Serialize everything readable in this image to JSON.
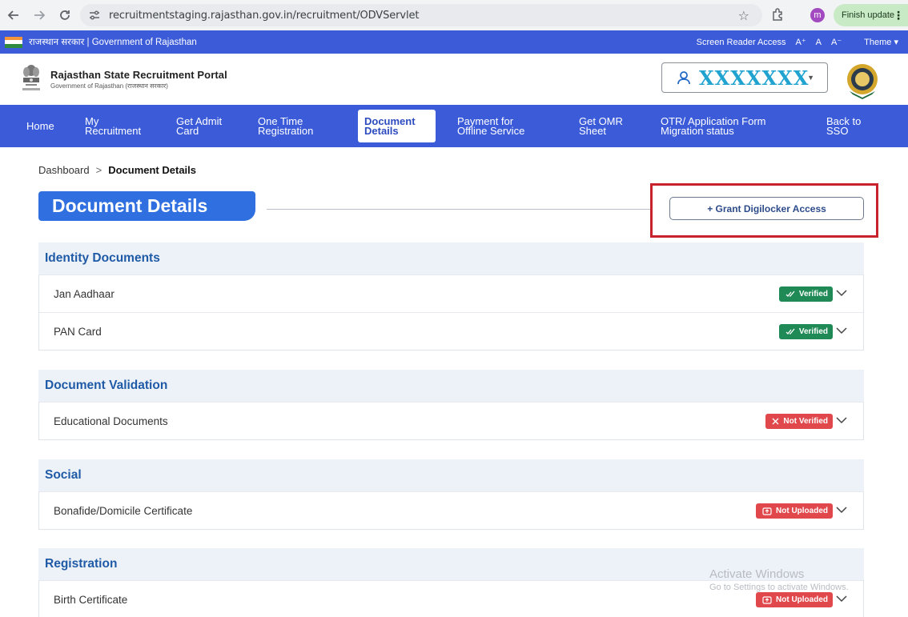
{
  "browser": {
    "url": "recruitmentstaging.rajasthan.gov.in/recruitment/ODVServlet",
    "profile_initial": "m",
    "finish_update": "Finish update"
  },
  "govbar": {
    "left_text": "राजस्थान सरकार | Government of Rajasthan",
    "screen_reader": "Screen Reader Access",
    "font_plus": "A⁺",
    "font_normal": "A",
    "font_minus": "A⁻",
    "theme": "Theme ▾"
  },
  "header": {
    "title": "Rajasthan State Recruitment Portal",
    "subtitle": "Government of Rajasthan (राजस्थान सरकार)",
    "user_name": "XXXXXXX",
    "caret": "▼"
  },
  "nav": [
    {
      "line1": "Home",
      "line2": ""
    },
    {
      "line1": "My",
      "line2": "Recruitment"
    },
    {
      "line1": "Get Admit",
      "line2": "Card"
    },
    {
      "line1": "One Time",
      "line2": "Registration"
    },
    {
      "line1": "Document",
      "line2": "Details"
    },
    {
      "line1": "Payment for",
      "line2": "Offline Service"
    },
    {
      "line1": "Get OMR",
      "line2": "Sheet"
    },
    {
      "line1": "OTR/ Application Form",
      "line2": "Migration status"
    },
    {
      "line1": "Back to",
      "line2": "SSO"
    }
  ],
  "breadcrumb": {
    "home": "Dashboard",
    "sep": ">",
    "current": "Document Details"
  },
  "page": {
    "title": "Document Details",
    "grant_button": "+ Grant Digilocker Access"
  },
  "sections": [
    {
      "title": "Identity Documents",
      "docs": [
        {
          "name": "Jan Aadhaar",
          "status": "Verified"
        },
        {
          "name": "PAN Card",
          "status": "Verified"
        }
      ]
    },
    {
      "title": "Document Validation",
      "docs": [
        {
          "name": "Educational Documents",
          "status": "Not Verified"
        }
      ]
    },
    {
      "title": "Social",
      "docs": [
        {
          "name": "Bonafide/Domicile Certificate",
          "status": "Not Uploaded"
        }
      ]
    },
    {
      "title": "Registration",
      "docs": [
        {
          "name": "Birth Certificate",
          "status": "Not Uploaded"
        }
      ]
    }
  ],
  "watermark": {
    "line1": "Activate Windows",
    "line2": "Go to Settings to activate Windows."
  },
  "colors": {
    "primary_blue": "#3b5bd9",
    "title_blue": "#2f6fe0",
    "verified_green": "#1f8a55",
    "error_red": "#e0484c",
    "highlight_red": "#c8232c"
  }
}
